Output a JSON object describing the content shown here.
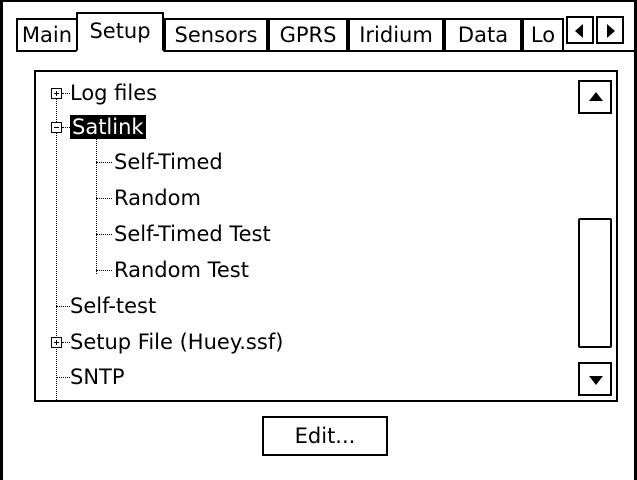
{
  "tabs": [
    {
      "label": "Main"
    },
    {
      "label": "Setup",
      "active": true
    },
    {
      "label": "Sensors"
    },
    {
      "label": "GPRS"
    },
    {
      "label": "Iridium"
    },
    {
      "label": "Data"
    },
    {
      "label": "Lo"
    }
  ],
  "tab_scroll": {
    "left_icon": "arrow-left-icon",
    "right_icon": "arrow-right-icon"
  },
  "tree": {
    "items": [
      {
        "label": "Log files",
        "expander": "plus"
      },
      {
        "label": "Satlink",
        "expander": "minus",
        "selected": true
      },
      {
        "label": "Self-Timed"
      },
      {
        "label": "Random"
      },
      {
        "label": "Self-Timed Test"
      },
      {
        "label": "Random Test"
      },
      {
        "label": "Self-test"
      },
      {
        "label": "Setup File (Huey.ssf)",
        "expander": "plus"
      },
      {
        "label": "SNTP"
      }
    ]
  },
  "scrollbar": {
    "up_icon": "scroll-up-icon",
    "down_icon": "scroll-down-icon"
  },
  "buttons": {
    "edit": "Edit..."
  }
}
